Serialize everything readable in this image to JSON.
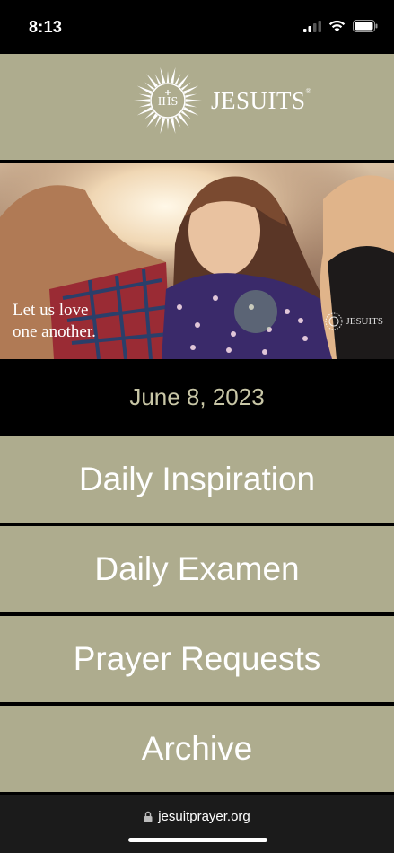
{
  "status_bar": {
    "time": "8:13"
  },
  "header": {
    "logo_text": "JESUITS",
    "logo_mark": "IHS"
  },
  "hero": {
    "caption_line1": "Let us love",
    "caption_line2": "one another.",
    "watermark": "JESUITS"
  },
  "date": "June 8, 2023",
  "nav": {
    "daily_inspiration": "Daily Inspiration",
    "daily_examen": "Daily Examen",
    "prayer_requests": "Prayer Requests",
    "archive": "Archive"
  },
  "browser": {
    "url": "jesuitprayer.org"
  },
  "colors": {
    "header_bg": "#aeac8e",
    "date_text": "#c8c6a6",
    "background": "#000000"
  },
  "icons": [
    "signal-icon",
    "wifi-icon",
    "battery-icon",
    "sunburst-logo-icon",
    "lock-icon"
  ]
}
